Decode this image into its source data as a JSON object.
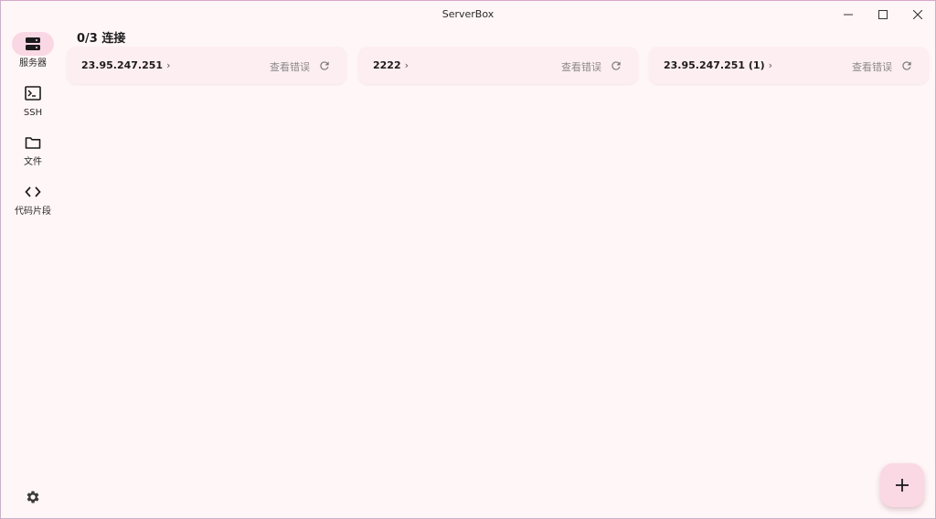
{
  "window": {
    "title": "ServerBox"
  },
  "rail": {
    "items": [
      {
        "label": "服务器",
        "icon": "server-icon",
        "active": true
      },
      {
        "label": "SSH",
        "icon": "terminal-icon",
        "active": false
      },
      {
        "label": "文件",
        "icon": "folder-icon",
        "active": false
      },
      {
        "label": "代码片段",
        "icon": "code-icon",
        "active": false
      }
    ],
    "settings_icon": "gear-icon"
  },
  "main": {
    "heading": "0/3 连接",
    "servers": [
      {
        "name": "23.95.247.251",
        "error_label": "查看错误"
      },
      {
        "name": "2222",
        "error_label": "查看错误"
      },
      {
        "name": "23.95.247.251 (1)",
        "error_label": "查看错误"
      }
    ],
    "fab_icon": "plus-icon"
  },
  "colors": {
    "background": "#fff6f7",
    "card": "#fdeef1",
    "accent": "#f9d8e4",
    "muted_text": "#8d8a8d"
  }
}
